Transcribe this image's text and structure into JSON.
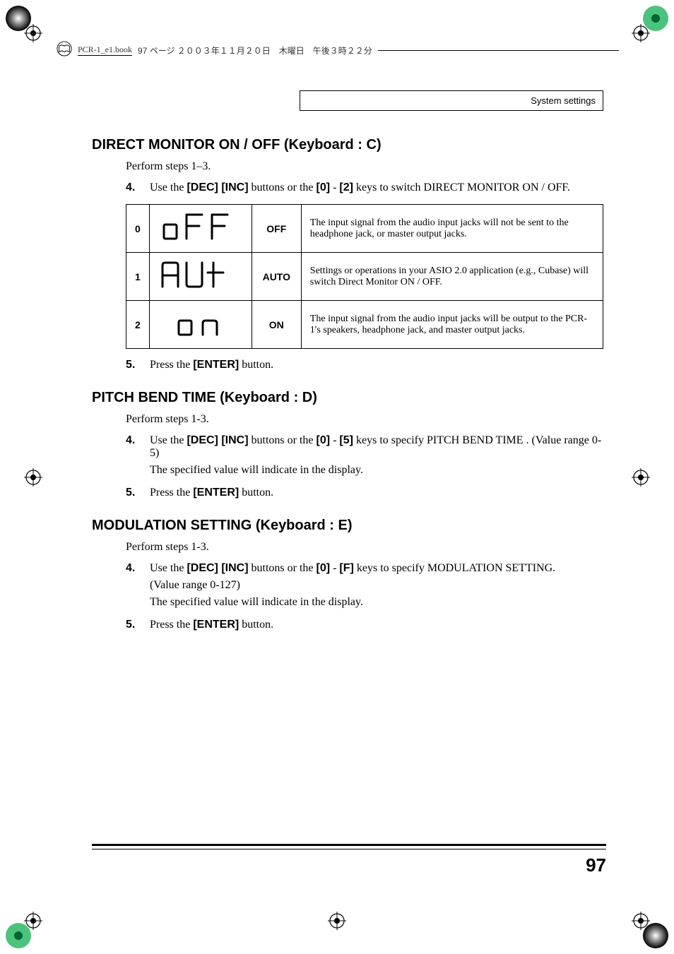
{
  "header": {
    "filename": "PCR-1_e1.book",
    "pageinfo": "97 ページ ２００３年１１月２０日　木曜日　午後３時２２分"
  },
  "breadcrumb": "System settings",
  "sections": {
    "direct_monitor": {
      "title": "DIRECT MONITOR ON / OFF  (Keyboard : C)",
      "intro": "Perform steps 1–3.",
      "step4_num": "4.",
      "step4_pre": "Use the ",
      "step4_b1": "[DEC] [INC]",
      "step4_mid1": " buttons or the ",
      "step4_b2": "[0]",
      "step4_dash": " - ",
      "step4_b3": "[2]",
      "step4_post": " keys to switch DIRECT MONITOR ON / OFF.",
      "rows": [
        {
          "n": "0",
          "label": "OFF",
          "desc": "The input signal from the audio input jacks will not be sent to the headphone jack, or master output jacks."
        },
        {
          "n": "1",
          "label": "AUTO",
          "desc": "Settings or operations in your ASIO 2.0 application (e.g., Cubase) will switch Direct Monitor ON / OFF."
        },
        {
          "n": "2",
          "label": "ON",
          "desc": "The input signal from the audio input jacks will be output to the PCR-1's speakers, headphone jack, and master output jacks."
        }
      ],
      "step5_num": "5.",
      "step5_pre": "Press the ",
      "step5_b": "[ENTER]",
      "step5_post": " button."
    },
    "pitch_bend": {
      "title": "PITCH BEND TIME  (Keyboard : D)",
      "intro": "Perform steps 1-3.",
      "step4_num": "4.",
      "step4_pre": " Use the ",
      "step4_b1": "[DEC] [INC]",
      "step4_mid1": " buttons or the ",
      "step4_b2": "[0]",
      "step4_dash": " - ",
      "step4_b3": "[5]",
      "step4_post": " keys to specify PITCH BEND TIME . (Value range 0-5)",
      "step4_line2": "The specified value will indicate in the display.",
      "step5_num": "5.",
      "step5_pre": "Press the ",
      "step5_b": "[ENTER]",
      "step5_post": " button."
    },
    "modulation": {
      "title": "MODULATION SETTING  (Keyboard : E)",
      "intro": "Perform steps 1-3.",
      "step4_num": "4.",
      "step4_pre": "Use the ",
      "step4_b1": "[DEC] [INC]",
      "step4_mid1": " buttons or the ",
      "step4_b2": "[0]",
      "step4_dash": " - ",
      "step4_b3": "[F]",
      "step4_post": " keys to specify MODULATION SETTING.",
      "step4_line2a": " (Value range 0-127)",
      "step4_line2b": "The specified value will indicate in the display.",
      "step5_num": "5.",
      "step5_pre": "Press the ",
      "step5_b": "[ENTER]",
      "step5_post": " button."
    }
  },
  "page_number": "97"
}
